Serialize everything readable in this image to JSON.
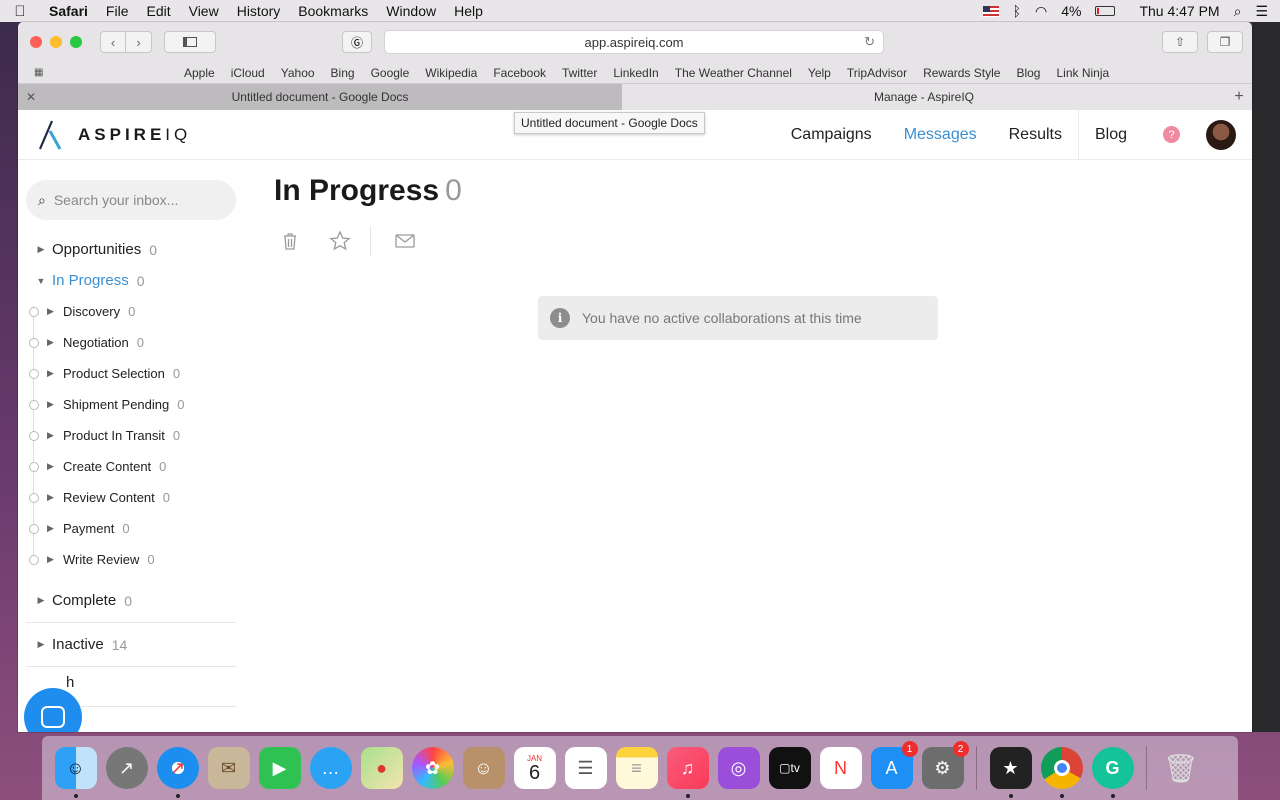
{
  "menubar": {
    "app_name": "Safari",
    "items": [
      "File",
      "Edit",
      "View",
      "History",
      "Bookmarks",
      "Window",
      "Help"
    ],
    "battery": "4%",
    "clock": "Thu 4:47 PM"
  },
  "browser": {
    "url": "app.aspireiq.com",
    "favorites": [
      "Apple",
      "iCloud",
      "Yahoo",
      "Bing",
      "Google",
      "Wikipedia",
      "Facebook",
      "Twitter",
      "LinkedIn",
      "The Weather Channel",
      "Yelp",
      "TripAdvisor",
      "Rewards Style",
      "Blog",
      "Link Ninja"
    ],
    "tabs": [
      {
        "title": "Untitled document - Google Docs",
        "active": false
      },
      {
        "title": "Manage - AspireIQ",
        "active": true
      }
    ],
    "tooltip": "Untitled document - Google Docs"
  },
  "app": {
    "logo_bold": "ASPIRE",
    "logo_light": "IQ",
    "nav": [
      {
        "label": "Campaigns",
        "active": false
      },
      {
        "label": "Messages",
        "active": true
      },
      {
        "label": "Results",
        "active": false
      },
      {
        "label": "Blog",
        "active": false
      }
    ],
    "help_glyph": "?"
  },
  "sidebar": {
    "search_placeholder": "Search your inbox...",
    "folders_top": [
      {
        "label": "Opportunities",
        "count": "0"
      }
    ],
    "active_folder": {
      "label": "In Progress",
      "count": "0"
    },
    "subfolders": [
      {
        "label": "Discovery",
        "count": "0"
      },
      {
        "label": "Negotiation",
        "count": "0"
      },
      {
        "label": "Product Selection",
        "count": "0"
      },
      {
        "label": "Shipment Pending",
        "count": "0"
      },
      {
        "label": "Product In Transit",
        "count": "0"
      },
      {
        "label": "Create Content",
        "count": "0"
      },
      {
        "label": "Review Content",
        "count": "0"
      },
      {
        "label": "Payment",
        "count": "0"
      },
      {
        "label": "Write Review",
        "count": "0"
      }
    ],
    "folders_bottom": [
      {
        "label": "Complete",
        "count": "0"
      },
      {
        "label": "Inactive",
        "count": "14"
      }
    ],
    "partial_item": "h"
  },
  "main": {
    "title": "In Progress",
    "count": "0",
    "notice": "You have no active collaborations at this time",
    "info_glyph": "i"
  },
  "dock": {
    "calendar_month": "JAN",
    "calendar_day": "6",
    "app_store_badge": "1",
    "settings_badge": "2"
  }
}
